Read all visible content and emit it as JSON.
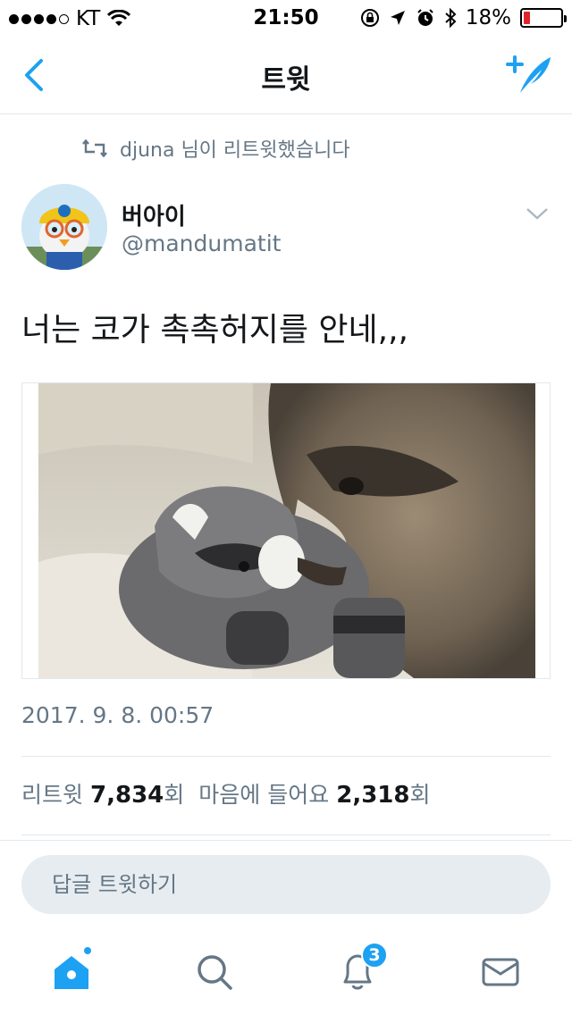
{
  "status_bar": {
    "carrier": "KT",
    "time": "21:50",
    "battery_percent": "18%",
    "battery_level": 0.18,
    "icons": [
      "signal-dots-icon",
      "wifi-icon",
      "orientation-lock-icon",
      "location-arrow-icon",
      "alarm-icon",
      "bluetooth-icon",
      "battery-icon"
    ]
  },
  "nav": {
    "title": "트윗",
    "back_icon": "chevron-left-icon",
    "compose_icon": "compose-tweet-icon"
  },
  "tweet": {
    "retweet_context": "djuna 님이 리트윗했습니다",
    "author_name": "버아이",
    "author_handle": "@mandumatit",
    "text": "너는 코가 촉촉허지를 안네,,,",
    "timestamp": "2017. 9. 8. 00:57",
    "stats": {
      "retweet_label": "리트윗",
      "retweet_count": "7,834",
      "retweet_unit": "회",
      "like_label": "마음에 들어요",
      "like_count": "2,318",
      "like_unit": "회"
    }
  },
  "reply": {
    "placeholder": "답글 트윗하기"
  },
  "tab_bar": {
    "notification_count": "3",
    "tabs": [
      "home-icon",
      "search-icon",
      "notifications-icon",
      "messages-icon"
    ]
  },
  "colors": {
    "accent": "#1da1f2",
    "secondary_text": "#657786",
    "divider": "#e1e8ed",
    "battery_low": "#e0242b"
  }
}
